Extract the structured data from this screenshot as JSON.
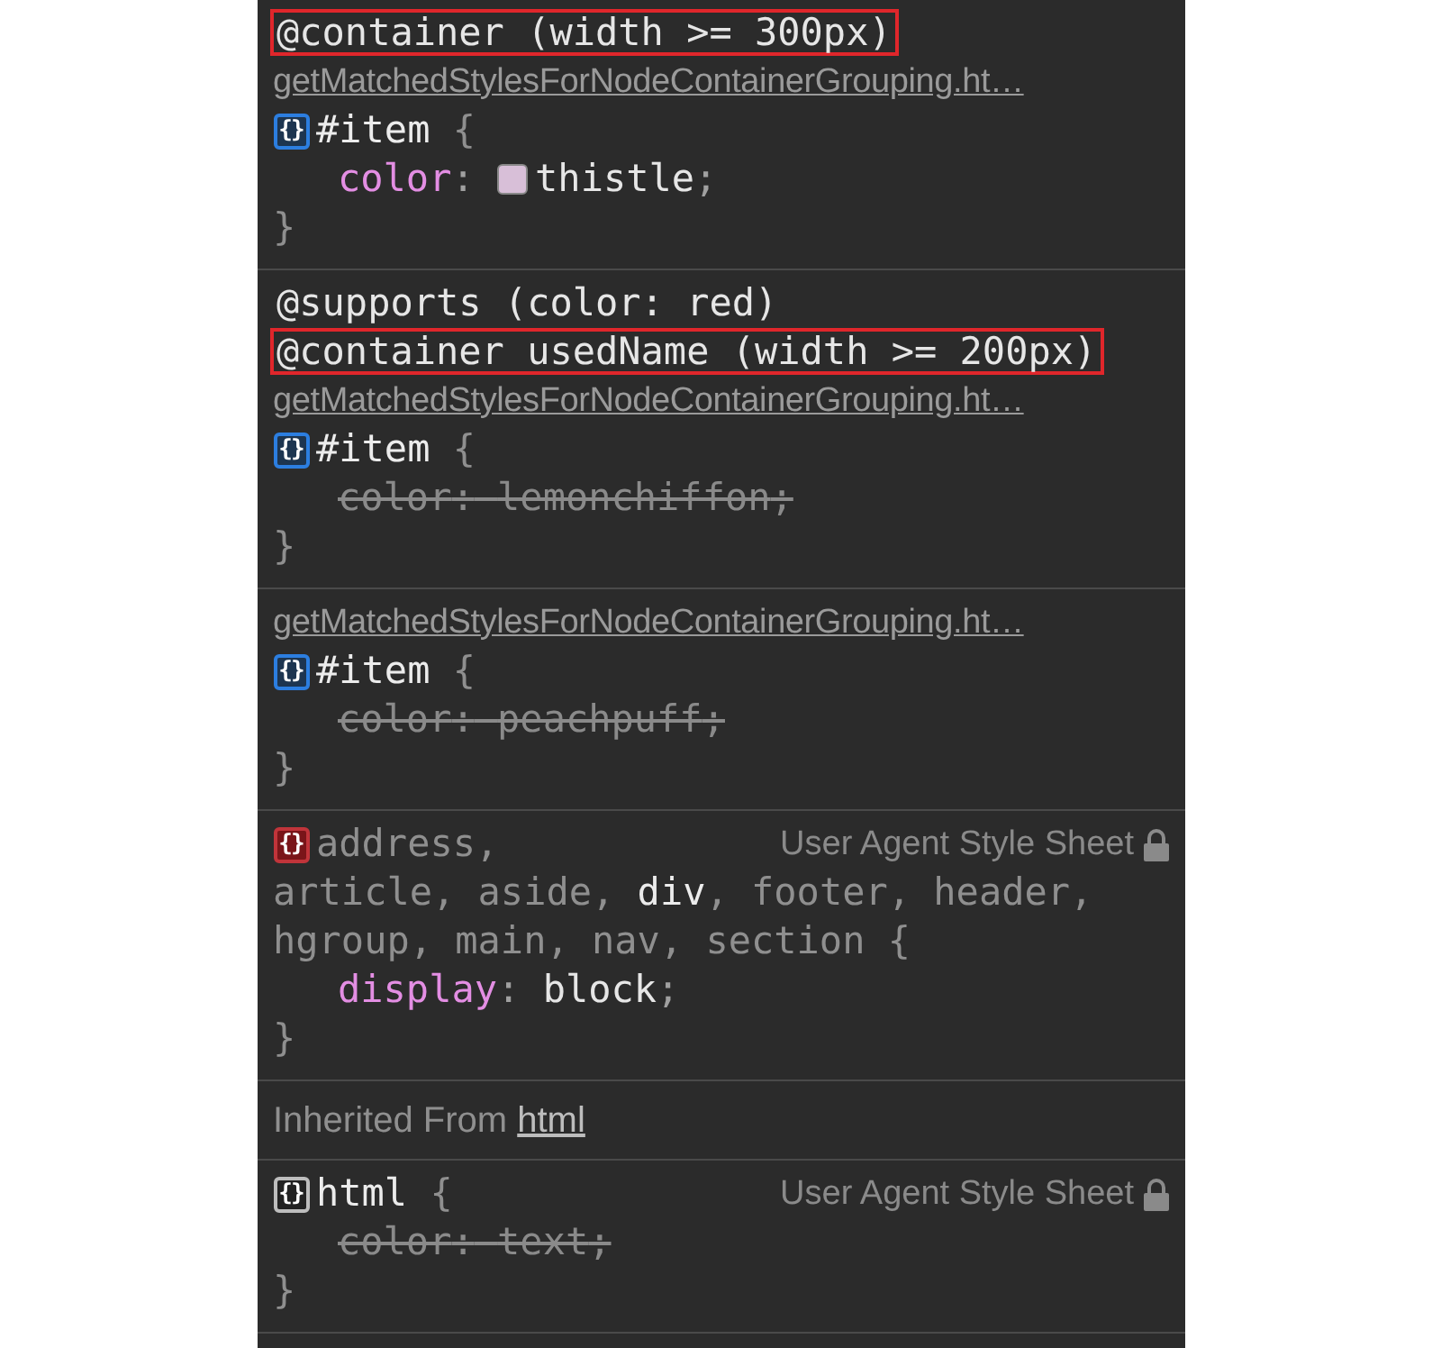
{
  "sections": [
    {
      "kind": "rule",
      "at_rules": [
        {
          "text": "@container (width >= 300px)",
          "highlighted": true
        }
      ],
      "source": "getMatchedStylesForNodeContainerGrouping.ht…",
      "badge": {
        "glyph": "{}",
        "kind": "author"
      },
      "selector_lines": [
        [
          {
            "text": "#item",
            "matched": true
          }
        ]
      ],
      "open_brace": "{",
      "declarations": [
        {
          "property": "color",
          "colon": ":",
          "value": "thistle",
          "semicolon": ";",
          "overridden": false,
          "color": "#d8bfd8"
        }
      ],
      "close_brace": "}"
    },
    {
      "kind": "rule",
      "at_rules": [
        {
          "text": "@supports (color: red)",
          "highlighted": false
        },
        {
          "text": "@container usedName (width >= 200px)",
          "highlighted": true
        }
      ],
      "source": "getMatchedStylesForNodeContainerGrouping.ht…",
      "badge": {
        "glyph": "{}",
        "kind": "author"
      },
      "selector_lines": [
        [
          {
            "text": "#item",
            "matched": true
          }
        ]
      ],
      "open_brace": "{",
      "declarations": [
        {
          "property": "color",
          "colon": ":",
          "value": "lemonchiffon",
          "semicolon": ";",
          "overridden": true
        }
      ],
      "close_brace": "}"
    },
    {
      "kind": "rule",
      "source": "getMatchedStylesForNodeContainerGrouping.ht…",
      "badge": {
        "glyph": "{}",
        "kind": "author"
      },
      "selector_lines": [
        [
          {
            "text": "#item",
            "matched": true
          }
        ]
      ],
      "open_brace": "{",
      "declarations": [
        {
          "property": "color",
          "colon": ":",
          "value": "peachpuff",
          "semicolon": ";",
          "overridden": true
        }
      ],
      "close_brace": "}"
    },
    {
      "kind": "rule",
      "badge": {
        "glyph": "{}",
        "kind": "user_agent"
      },
      "origin": "User Agent Style Sheet",
      "locked": true,
      "selector_lines": [
        [
          {
            "text": "address,",
            "matched": false
          }
        ],
        [
          {
            "text": "article, aside, ",
            "matched": false
          },
          {
            "text": "div",
            "matched": true
          },
          {
            "text": ", footer, header,",
            "matched": false
          }
        ],
        [
          {
            "text": "hgroup, main, nav, section",
            "matched": false
          }
        ]
      ],
      "open_brace": "{",
      "declarations": [
        {
          "property": "display",
          "colon": ":",
          "value": "block",
          "semicolon": ";",
          "overridden": false
        }
      ],
      "close_brace": "}"
    },
    {
      "kind": "inherited",
      "label": "Inherited From",
      "link": "html"
    },
    {
      "kind": "rule",
      "badge": {
        "glyph": "{}",
        "kind": "inherited"
      },
      "origin": "User Agent Style Sheet",
      "locked": true,
      "selector_lines": [
        [
          {
            "text": "html",
            "matched": true
          }
        ]
      ],
      "open_brace": "{",
      "declarations": [
        {
          "property": "color",
          "colon": ":",
          "value": "text",
          "semicolon": ";",
          "overridden": true
        }
      ],
      "close_brace": "}"
    }
  ]
}
